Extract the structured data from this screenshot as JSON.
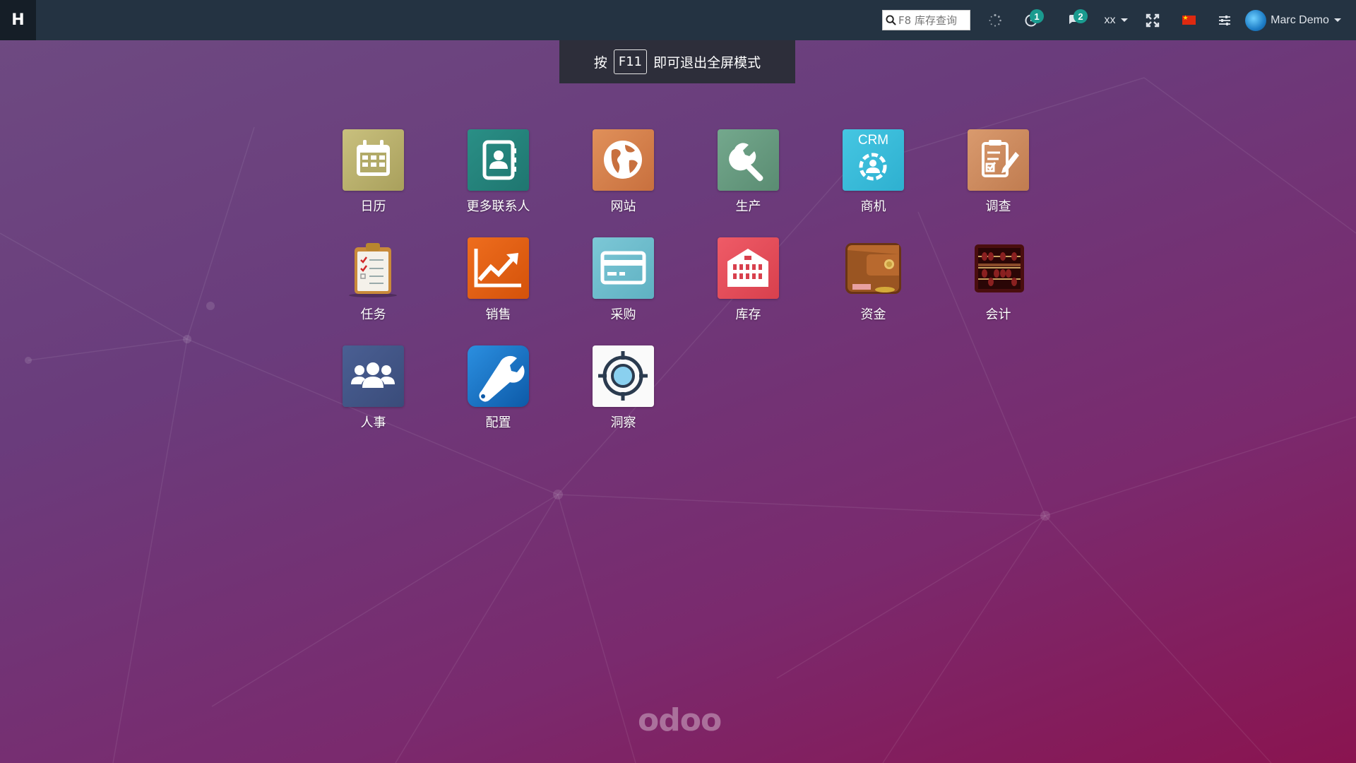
{
  "topbar": {
    "home_letter": "H",
    "search_placeholder": "F8 库存查询",
    "activity_count": "1",
    "messages_count": "2",
    "company": "xx",
    "user_name": "Marc Demo"
  },
  "fullscreen_notice": {
    "prefix": "按",
    "key": "F11",
    "suffix": "即可退出全屏模式"
  },
  "apps": [
    {
      "label": "日历",
      "icon": "calendar-icon"
    },
    {
      "label": "更多联系人",
      "icon": "contacts-icon"
    },
    {
      "label": "网站",
      "icon": "globe-icon"
    },
    {
      "label": "生产",
      "icon": "wrench-icon"
    },
    {
      "label": "商机",
      "icon": "crm-icon",
      "icon_text": "CRM"
    },
    {
      "label": "调查",
      "icon": "survey-icon"
    },
    {
      "label": "任务",
      "icon": "clipboard-icon"
    },
    {
      "label": "销售",
      "icon": "sales-chart-icon"
    },
    {
      "label": "采购",
      "icon": "credit-card-icon"
    },
    {
      "label": "库存",
      "icon": "warehouse-icon"
    },
    {
      "label": "资金",
      "icon": "wallet-icon"
    },
    {
      "label": "会计",
      "icon": "abacus-icon"
    },
    {
      "label": "人事",
      "icon": "users-icon"
    },
    {
      "label": "配置",
      "icon": "settings-wrench-icon"
    },
    {
      "label": "洞察",
      "icon": "target-icon"
    }
  ],
  "footer_logo": "odoo",
  "colors": {
    "topbar": "#243342",
    "badge": "#1a9b8f"
  }
}
